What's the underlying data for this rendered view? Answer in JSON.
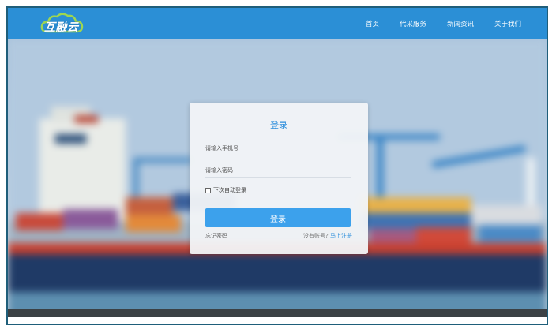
{
  "brand": {
    "logo_text": "互融云"
  },
  "nav": {
    "items": [
      "首页",
      "代采服务",
      "新闻资讯",
      "关于我们"
    ]
  },
  "login": {
    "title": "登录",
    "phone_placeholder": "请输入手机号",
    "password_placeholder": "请输入密码",
    "remember_label": "下次自动登录",
    "submit_label": "登录",
    "forgot_label": "忘记密码",
    "no_account_text": "没有账号? ",
    "register_prefix": "马上",
    "register_label": "注册"
  },
  "colors": {
    "topbar": "#2b8fd6",
    "accent": "#3ca1ec",
    "link": "#2e8fdc"
  },
  "icons": {
    "logo": "cloud-logo-icon",
    "remember": "checkbox-icon"
  }
}
